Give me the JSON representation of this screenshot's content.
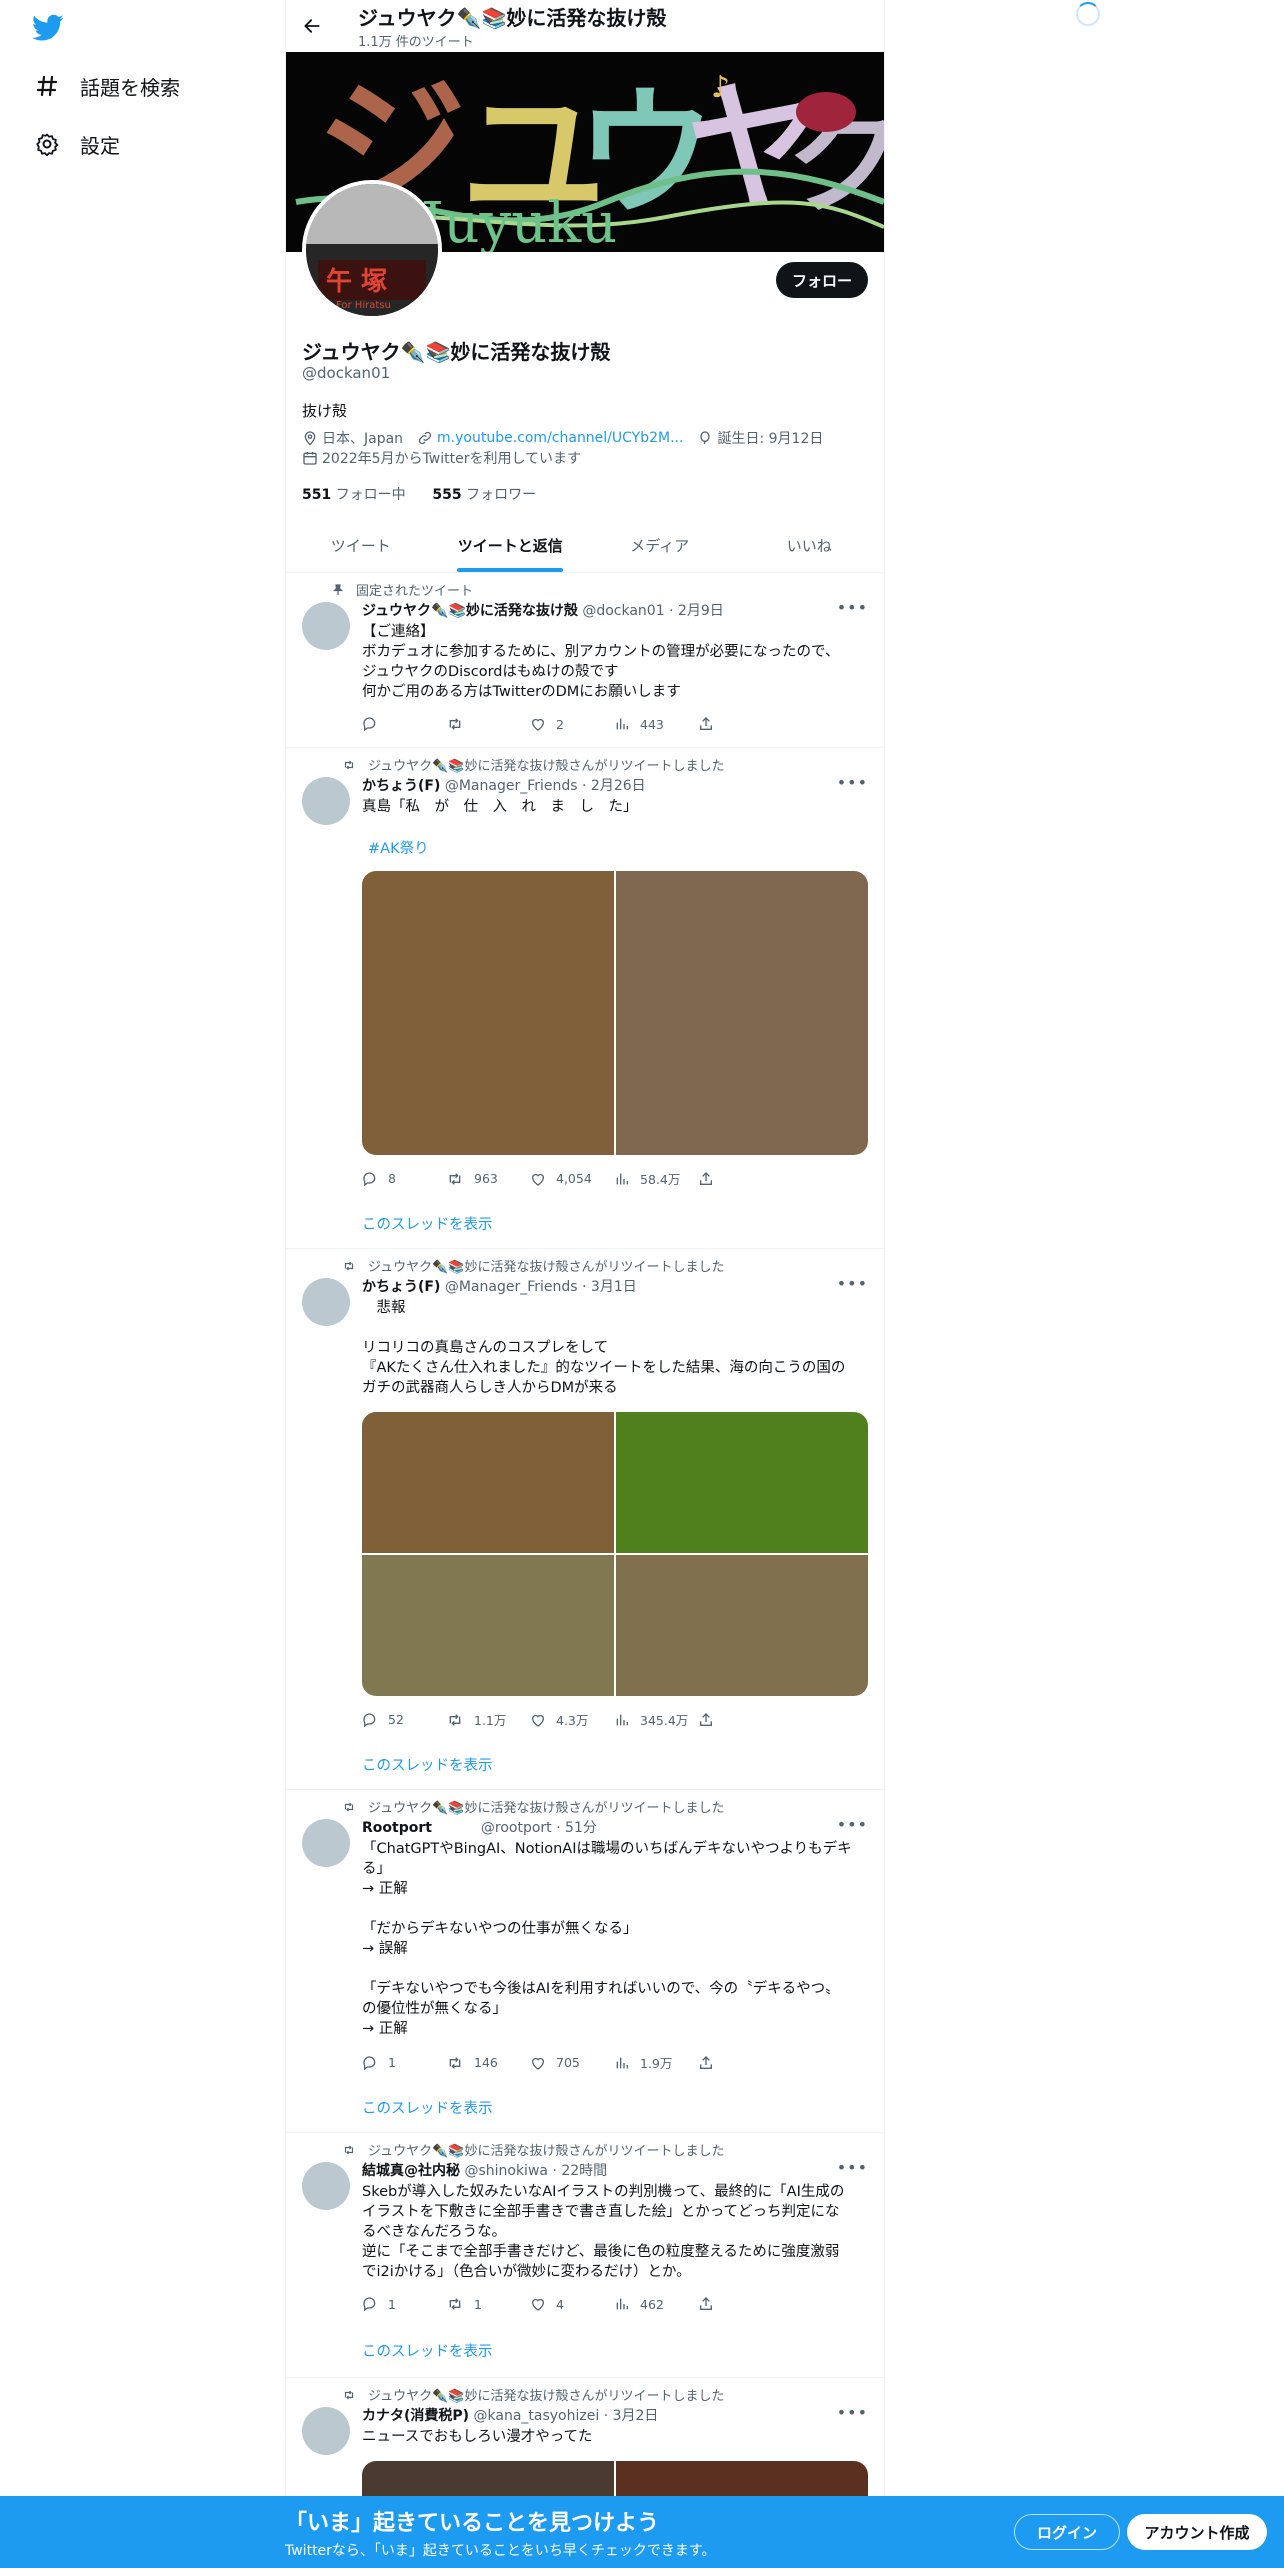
{
  "nav": {
    "explore_label": "話題を検索",
    "settings_label": "設定"
  },
  "header": {
    "name": "ジュウヤク✒️📚妙に活発な抜け殻",
    "tweet_count": "1.1万 件のツイート"
  },
  "banner": {
    "title_text": "ジュウヤク",
    "subtitle_text": "Juyuku"
  },
  "avatar": {
    "sign_text": "午 塚",
    "sign_sub": "For Hiratsu"
  },
  "profile": {
    "follow_label": "フォロー",
    "name": "ジュウヤク✒️📚妙に活発な抜け殻",
    "handle": "@dockan01",
    "bio": "抜け殻",
    "location": "日本、Japan",
    "url": "m.youtube.com/channel/UCYb2M...",
    "birthday": "誕生日: 9月12日",
    "joined": "2022年5月からTwitterを利用しています",
    "following_count": "551",
    "following_label": "フォロー中",
    "followers_count": "555",
    "followers_label": "フォロワー"
  },
  "tabs": [
    "ツイート",
    "ツイートと返信",
    "メディア",
    "いいね"
  ],
  "tweets": [
    {
      "context": "固定されたツイート",
      "name": "ジュウヤク✒️📚妙に活発な抜け殻",
      "handle": "@dockan01",
      "time": "2月9日",
      "text": "【ご連絡】\nボカデュオに参加するために、別アカウントの管理が必要になったので、\nジュウヤクのDiscordはもぬけの殻です\n何かご用のある方はTwitterのDMにお願いします",
      "replies": "",
      "retweets": "",
      "likes": "2",
      "views": "443"
    },
    {
      "context": "ジュウヤク✒️📚妙に活発な抜け殻さんがリツイートしました",
      "name": "かちょう(F)",
      "handle": "@Manager_Friends",
      "time": "2月26日",
      "text": "真島「私　が　仕　入　れ　ま　し　た」",
      "hashtag": "#AK祭り",
      "replies": "8",
      "retweets": "963",
      "likes": "4,054",
      "views": "58.4万",
      "thread": "このスレッドを表示"
    },
    {
      "context": "ジュウヤク✒️📚妙に活発な抜け殻さんがリツイートしました",
      "name": "かちょう(F)",
      "handle": "@Manager_Friends",
      "time": "3月1日",
      "text": "　悲報\n\nリコリコの真島さんのコスプレをして\n『AKたくさん仕入れました』的なツイートをした結果、海の向こうの国の\nガチの武器商人らしき人からDMが来る",
      "replies": "52",
      "retweets": "1.1万",
      "likes": "4.3万",
      "views": "345.4万",
      "thread": "このスレッドを表示"
    },
    {
      "context": "ジュウヤク✒️📚妙に活発な抜け殻さんがリツイートしました",
      "name": "Rootport",
      "handle": "@rootport",
      "time": "51分",
      "text": "「ChatGPTやBingAI、NotionAIは職場のいちばんデキないやつよりもデキ\nる」\n→ 正解\n\n「だからデキないやつの仕事が無くなる」\n→ 誤解\n\n「デキないやつでも今後はAIを利用すればいいので、今の〝デキるやつ〟\nの優位性が無くなる」\n→ 正解",
      "replies": "1",
      "retweets": "146",
      "likes": "705",
      "views": "1.9万",
      "thread": "このスレッドを表示"
    },
    {
      "context": "ジュウヤク✒️📚妙に活発な抜け殻さんがリツイートしました",
      "name": "結城真@社内秘",
      "handle": "@shinokiwa",
      "time": "22時間",
      "text": "Skebが導入した奴みたいなAIイラストの判別機って、最終的に「AI生成の\nイラストを下敷きに全部手書きで書き直した絵」とかってどっち判定にな\nるべきなんだろうな。\n逆に「そこまで全部手書きだけど、最後に色の粒度整えるために強度激弱\nでi2iかける」（色合いが微妙に変わるだけ）とか。",
      "replies": "1",
      "retweets": "1",
      "likes": "4",
      "views": "462",
      "thread": "このスレッドを表示"
    },
    {
      "context": "ジュウヤク✒️📚妙に活発な抜け殻さんがリツイートしました",
      "name": "カナタ(消費税P)",
      "handle": "@kana_tasyohizei",
      "time": "3月2日",
      "text": "ニュースでおもしろい漫才やってた"
    }
  ],
  "bottom": {
    "title": "「いま」起きていることを見つけよう",
    "subtitle": "Twitterなら、「いま」起きていることをいち早くチェックできます。",
    "login_label": "ログイン",
    "signup_label": "アカウント作成"
  },
  "colors": {
    "accent": "#1d9bf0",
    "text": "#0f1419",
    "muted": "#536471"
  }
}
